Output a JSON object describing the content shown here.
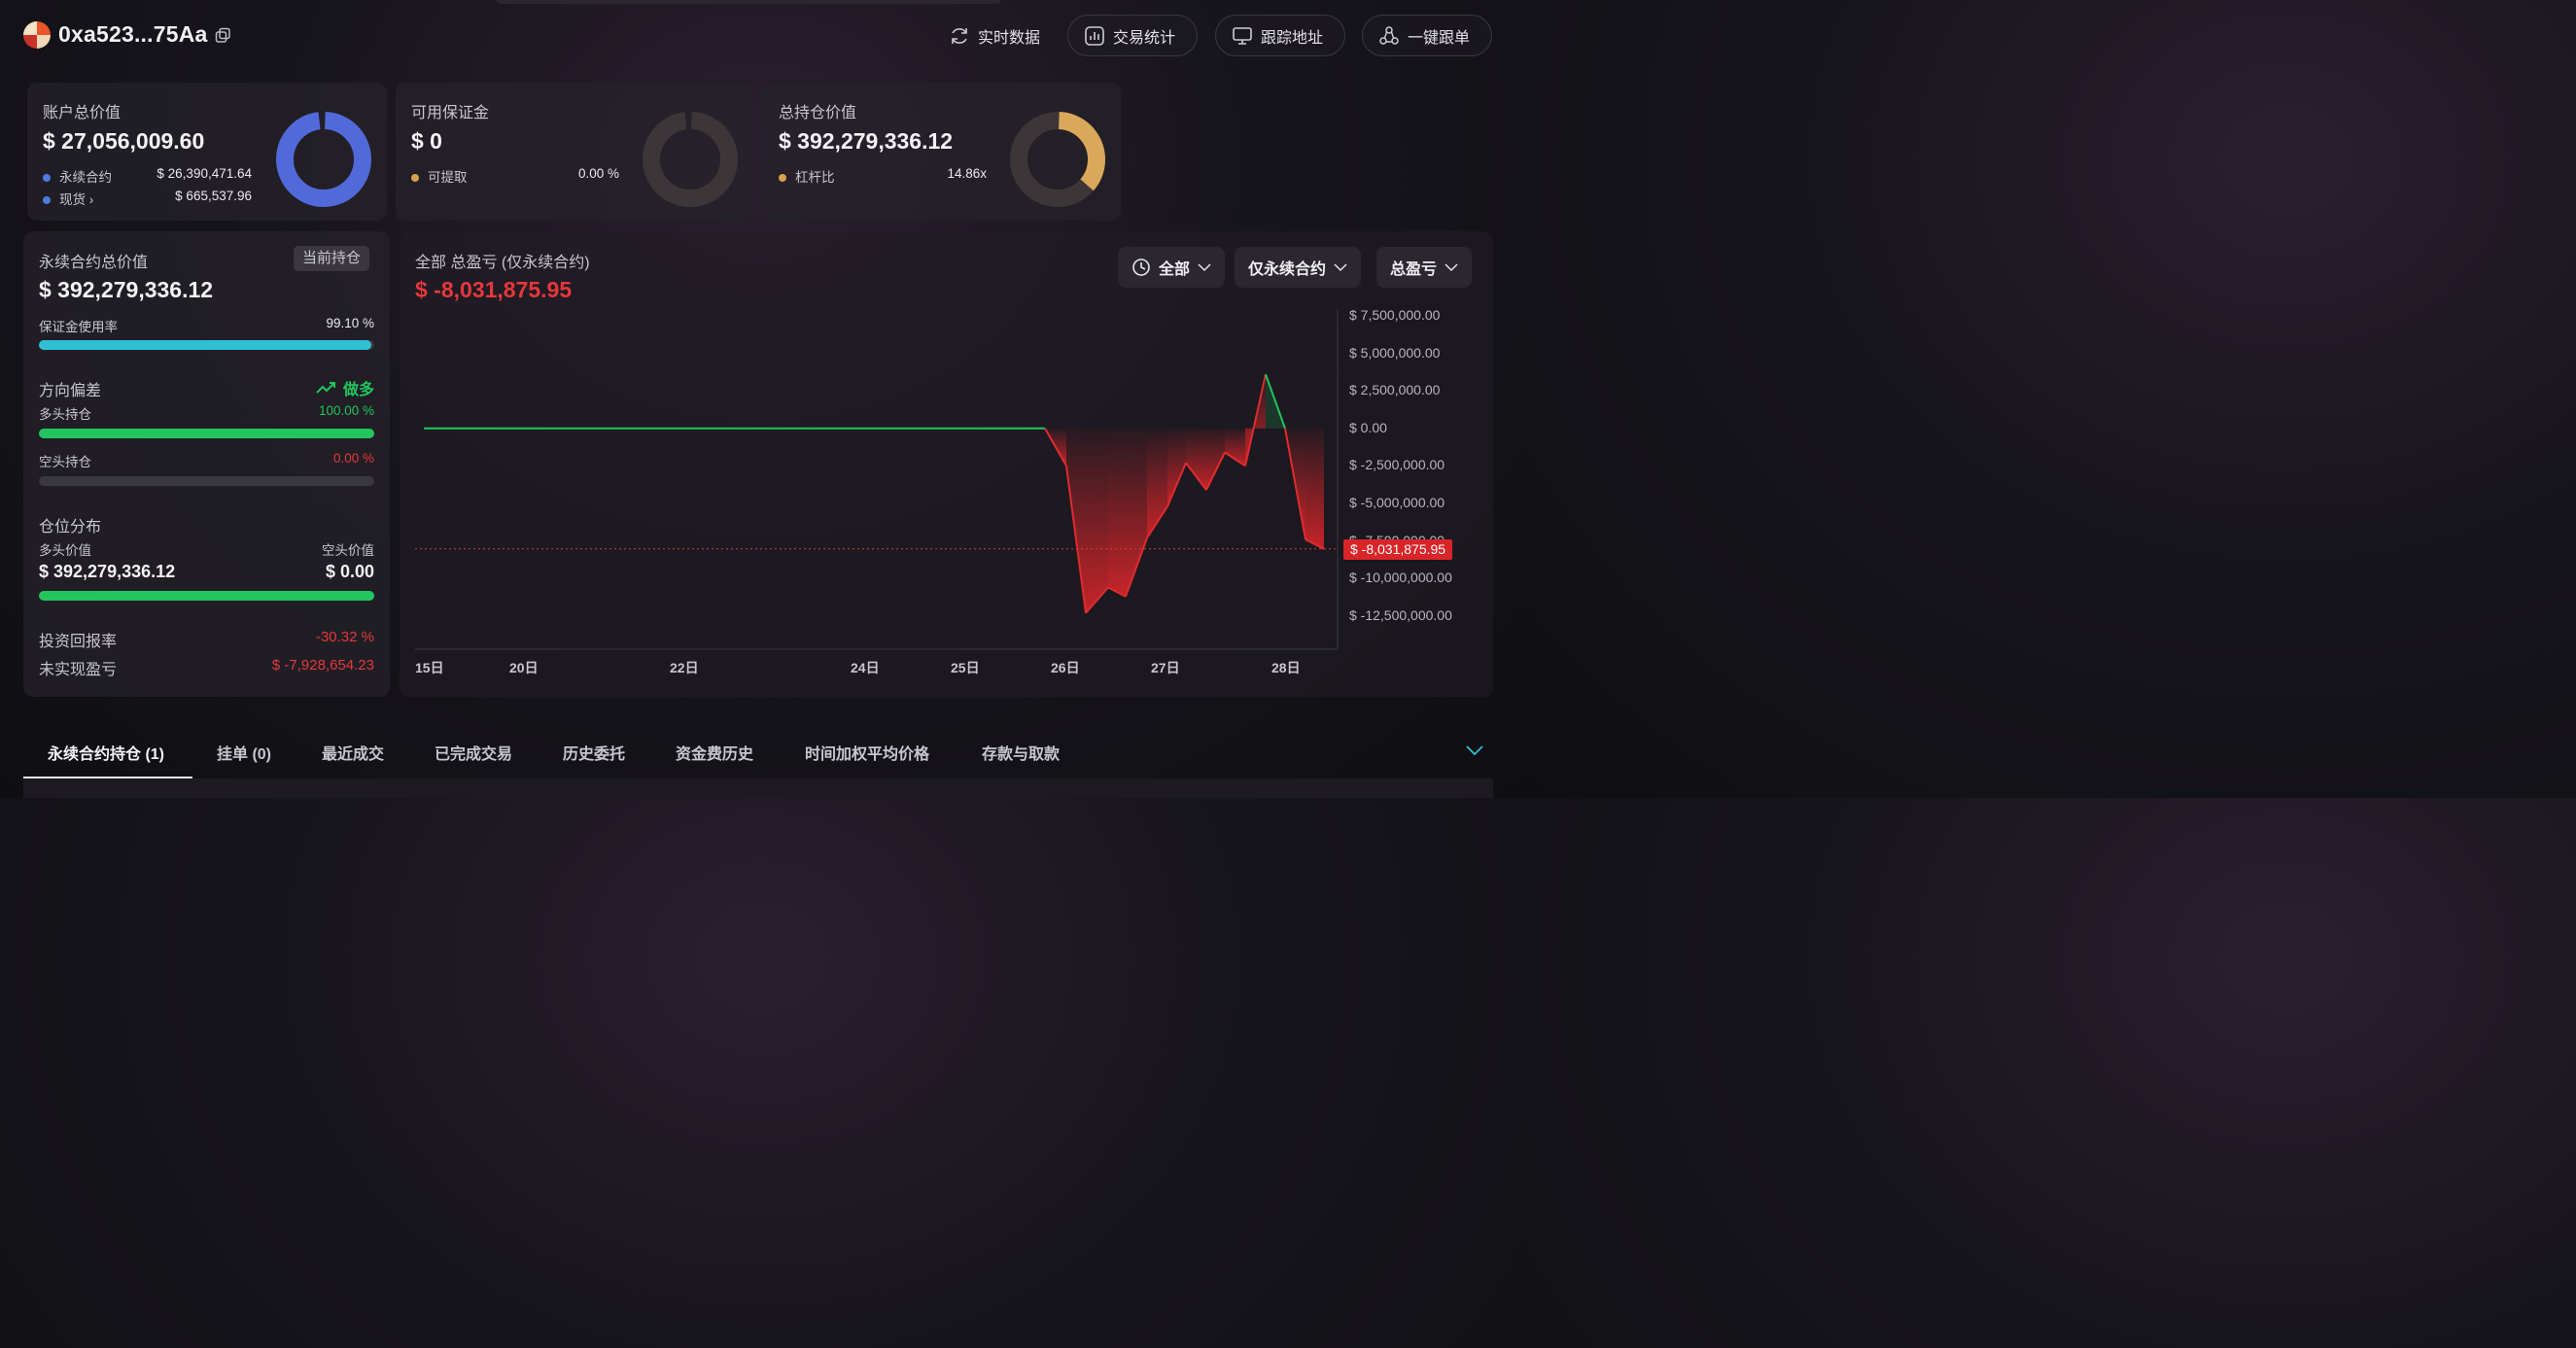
{
  "header": {
    "address": "0xa523...75Aa",
    "buttons": [
      {
        "label": "实时数据",
        "icon": "refresh-icon"
      },
      {
        "label": "交易统计",
        "icon": "stats-icon"
      },
      {
        "label": "跟踪地址",
        "icon": "monitor-icon"
      },
      {
        "label": "一键跟单",
        "icon": "share-nodes-icon"
      }
    ]
  },
  "account": {
    "title": "账户总价值",
    "value": "$ 27,056,009.60",
    "rows": [
      {
        "label": "永续合约",
        "value": "$ 26,390,471.64",
        "color": "#4f7be0"
      },
      {
        "label": "现货",
        "value": "$ 665,537.96",
        "color": "#4f7be0"
      }
    ],
    "donut_color": "#5269d9"
  },
  "margin": {
    "title": "可用保证金",
    "value": "$ 0",
    "row_label": "可提取",
    "row_value": "0.00 %",
    "dot_color": "#d7a24b"
  },
  "position": {
    "title": "总持仓价值",
    "value": "$ 392,279,336.12",
    "row_label": "杠杆比",
    "row_value": "14.86x",
    "dot_color": "#d7a24b",
    "donut_color": "#d9a85a"
  },
  "perp": {
    "title": "永续合约总价值",
    "badge": "当前持仓",
    "value": "$ 392,279,336.12",
    "margin_usage_label": "保证金使用率",
    "margin_usage_value": "99.10 %",
    "margin_usage_fraction": 0.991,
    "bias_title": "方向偏差",
    "bias_value": "做多",
    "long_label": "多头持仓",
    "long_value": "100.00 %",
    "short_label": "空头持仓",
    "short_value": "0.00 %",
    "dist_title": "仓位分布",
    "long_val_label": "多头价值",
    "short_val_label": "空头价值",
    "long_val": "$ 392,279,336.12",
    "short_val": "$ 0.00",
    "roi_label": "投资回报率",
    "roi_value": "-30.32 %",
    "upnl_label": "未实现盈亏",
    "upnl_value": "$ -7,928,654.23"
  },
  "pnl": {
    "title": "全部 总盈亏 (仅永续合约)",
    "value": "$ -8,031,875.95",
    "filters": [
      "全部",
      "仅永续合约",
      "总盈亏"
    ],
    "current_label": "$ -8,031,875.95"
  },
  "chart_data": {
    "type": "line",
    "x_ticks": [
      "15日",
      "20日",
      "22日",
      "24日",
      "25日",
      "26日",
      "27日",
      "28日"
    ],
    "y_ticks": [
      "$ 7,500,000.00",
      "$ 5,000,000.00",
      "$ 2,500,000.00",
      "$ 0.00",
      "$ -2,500,000.00",
      "$ -5,000,000.00",
      "$ -7,500,000.00",
      "$ -10,000,000.00",
      "$ -12,500,000.00"
    ],
    "ylim": [
      -12500000,
      7500000
    ],
    "current_value": -8031875.95,
    "points": [
      {
        "x": "15日",
        "y": 0
      },
      {
        "x": "26日",
        "y": 0
      },
      {
        "x": "26日",
        "y": -2500000
      },
      {
        "x": "26日",
        "y": -12300000
      },
      {
        "x": "26日",
        "y": -10600000
      },
      {
        "x": "27日",
        "y": -11200000
      },
      {
        "x": "27日",
        "y": -7300000
      },
      {
        "x": "27日",
        "y": -5200000
      },
      {
        "x": "27日",
        "y": -2300000
      },
      {
        "x": "27日",
        "y": -4100000
      },
      {
        "x": "27日",
        "y": -1600000
      },
      {
        "x": "27日",
        "y": -2500000
      },
      {
        "x": "28日",
        "y": 3600000
      },
      {
        "x": "28日",
        "y": 0
      },
      {
        "x": "28日",
        "y": -7400000
      },
      {
        "x": "28日",
        "y": -8031875.95
      }
    ]
  },
  "tabs": [
    {
      "label": "永续合约持仓 (1)"
    },
    {
      "label": "挂单 (0)"
    },
    {
      "label": "最近成交"
    },
    {
      "label": "已完成交易"
    },
    {
      "label": "历史委托"
    },
    {
      "label": "资金费历史"
    },
    {
      "label": "时间加权平均价格"
    },
    {
      "label": "存款与取款"
    }
  ]
}
